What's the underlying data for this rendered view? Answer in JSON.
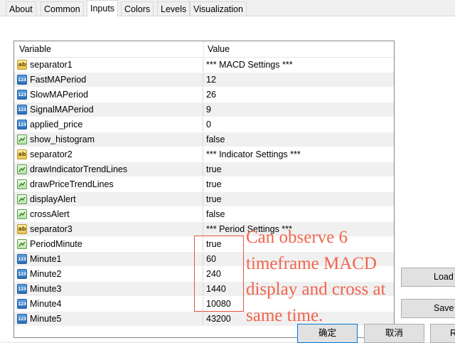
{
  "tabs": [
    {
      "label": "About"
    },
    {
      "label": "Common"
    },
    {
      "label": "Inputs"
    },
    {
      "label": "Colors"
    },
    {
      "label": "Levels"
    },
    {
      "label": "Visualization"
    }
  ],
  "active_tab": "Inputs",
  "table": {
    "headers": {
      "variable": "Variable",
      "value": "Value"
    },
    "rows": [
      {
        "icon": "string-icon",
        "variable": "separator1",
        "value": "*** MACD Settings ***"
      },
      {
        "icon": "number-icon",
        "variable": "FastMAPeriod",
        "value": "12"
      },
      {
        "icon": "number-icon",
        "variable": "SlowMAPeriod",
        "value": "26"
      },
      {
        "icon": "number-icon",
        "variable": "SignalMAPeriod",
        "value": "9"
      },
      {
        "icon": "number-icon",
        "variable": "applied_price",
        "value": "0"
      },
      {
        "icon": "boolean-icon",
        "variable": "show_histogram",
        "value": "false"
      },
      {
        "icon": "string-icon",
        "variable": "separator2",
        "value": "*** Indicator Settings ***"
      },
      {
        "icon": "boolean-icon",
        "variable": "drawIndicatorTrendLines",
        "value": "true"
      },
      {
        "icon": "boolean-icon",
        "variable": "drawPriceTrendLines",
        "value": "true"
      },
      {
        "icon": "boolean-icon",
        "variable": "displayAlert",
        "value": "true"
      },
      {
        "icon": "boolean-icon",
        "variable": "crossAlert",
        "value": "false"
      },
      {
        "icon": "string-icon",
        "variable": "separator3",
        "value": "*** Period Settings ***"
      },
      {
        "icon": "boolean-icon",
        "variable": "PeriodMinute",
        "value": "true"
      },
      {
        "icon": "number-icon",
        "variable": "Minute1",
        "value": "60"
      },
      {
        "icon": "number-icon",
        "variable": "Minute2",
        "value": "240"
      },
      {
        "icon": "number-icon",
        "variable": "Minute3",
        "value": "1440"
      },
      {
        "icon": "number-icon",
        "variable": "Minute4",
        "value": "10080"
      },
      {
        "icon": "number-icon",
        "variable": "Minute5",
        "value": "43200"
      }
    ]
  },
  "annotation": {
    "text": "Can observe 6\ntimeframe MACD\ndisplay and cross at\nsame time.",
    "color": "#f0654d"
  },
  "side_buttons": {
    "load": "Load",
    "save": "Save"
  },
  "footer_buttons": {
    "ok": "确定",
    "cancel": "取消",
    "reset": "R"
  }
}
